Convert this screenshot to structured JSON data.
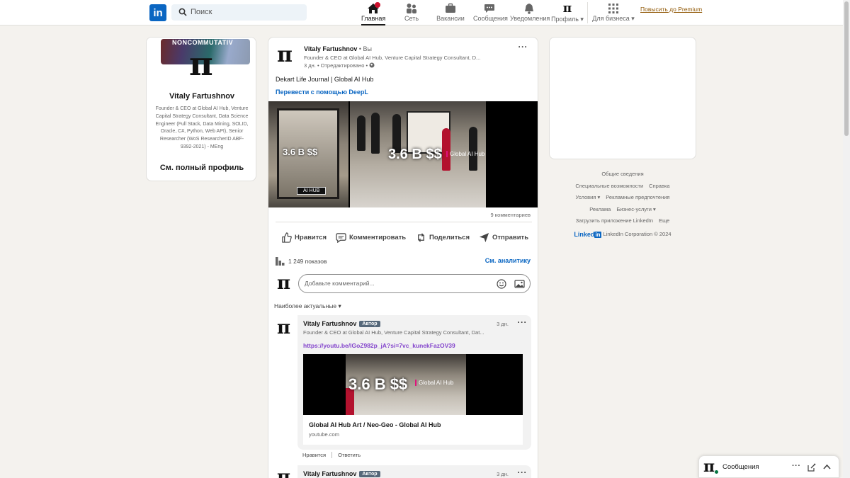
{
  "nav": {
    "logo": "in",
    "search_placeholder": "Поиск",
    "items": [
      {
        "label": "Главная",
        "icon": "home-icon"
      },
      {
        "label": "Сеть",
        "icon": "network-icon"
      },
      {
        "label": "Вакансии",
        "icon": "briefcase-icon"
      },
      {
        "label": "Сообщения",
        "icon": "messaging-icon"
      },
      {
        "label": "Уведомления",
        "icon": "bell-icon"
      },
      {
        "label": "Профиль ▾",
        "icon": "avatar"
      },
      {
        "label": "Для бизнеса ▾",
        "icon": "grid-icon"
      }
    ],
    "premium": "Повысить до Premium",
    "accent": "#0a66c2"
  },
  "profile": {
    "banner_text": "NONCOMMUTATIV",
    "avatar_glyph": "π",
    "name": "Vitaly Fartushnov",
    "headline": "Founder & CEO at Global AI Hub, Venture Capital Strategy Consultant, Data Science Engineer (Full Stack, Data Mining, SOLID, Oracle, C#, Python, Web API), Senior Researcher (WoS ResearcherID ABF-9392-2021) - MEng",
    "full_profile": "См. полный профиль"
  },
  "post": {
    "author": "Vitaly Fartushnov",
    "you": " • Вы",
    "headline": "Founder & CEO at Global AI Hub, Venture Capital Strategy Consultant, D...",
    "time": "3 дн. • Отредактировано •",
    "text": "Dekart Life Journal | Global AI Hub",
    "translate": "Перевести с помощью DeepL",
    "media_text_1": "3.6 B $$",
    "media_text_2": "3.6 B $$",
    "media_sub_1": "AI HUB",
    "media_sub_2": "Global AI Hub",
    "comments_count": "9 комментариев",
    "actions": [
      "Нравится",
      "Комментировать",
      "Поделиться",
      "Отправить"
    ],
    "views": "1 249 показов",
    "analytics": "См. аналитику",
    "comment_placeholder": "Добавьте комментарий...",
    "sort": "Наиболее актуальные ▾"
  },
  "comments": [
    {
      "name": "Vitaly Fartushnov",
      "badge": "Автор",
      "headline": "Founder & CEO at Global AI Hub, Venture Capital Strategy Consultant, Dat...",
      "time": "3 дн.",
      "link": "https://youtu.be/lGoZ982p_jA?si=7vc_kunekFazOV39",
      "preview_big": "3.6 B $$",
      "preview_hub": "Global AI Hub",
      "preview_title": "Global AI Hub Art / Neo-Geo - Global AI Hub",
      "preview_domain": "youtube.com",
      "like": "Нравится",
      "reply": "Ответить"
    },
    {
      "name": "Vitaly Fartushnov",
      "badge": "Автор",
      "time": "3 дн."
    }
  ],
  "footer": {
    "rows": [
      [
        "Общие сведения"
      ],
      [
        "Специальные возможности",
        "Справка"
      ],
      [
        "Условия ▾",
        "Рекламные предпочтения"
      ],
      [
        "Реклама",
        "Бизнес-услуги ▾"
      ],
      [
        "Загрузить приложение LinkedIn",
        "Еще"
      ]
    ],
    "brand": "Linked",
    "brand_in": "in",
    "copyright": "LinkedIn Corporation © 2024"
  },
  "messaging": {
    "label": "Сообщения"
  }
}
